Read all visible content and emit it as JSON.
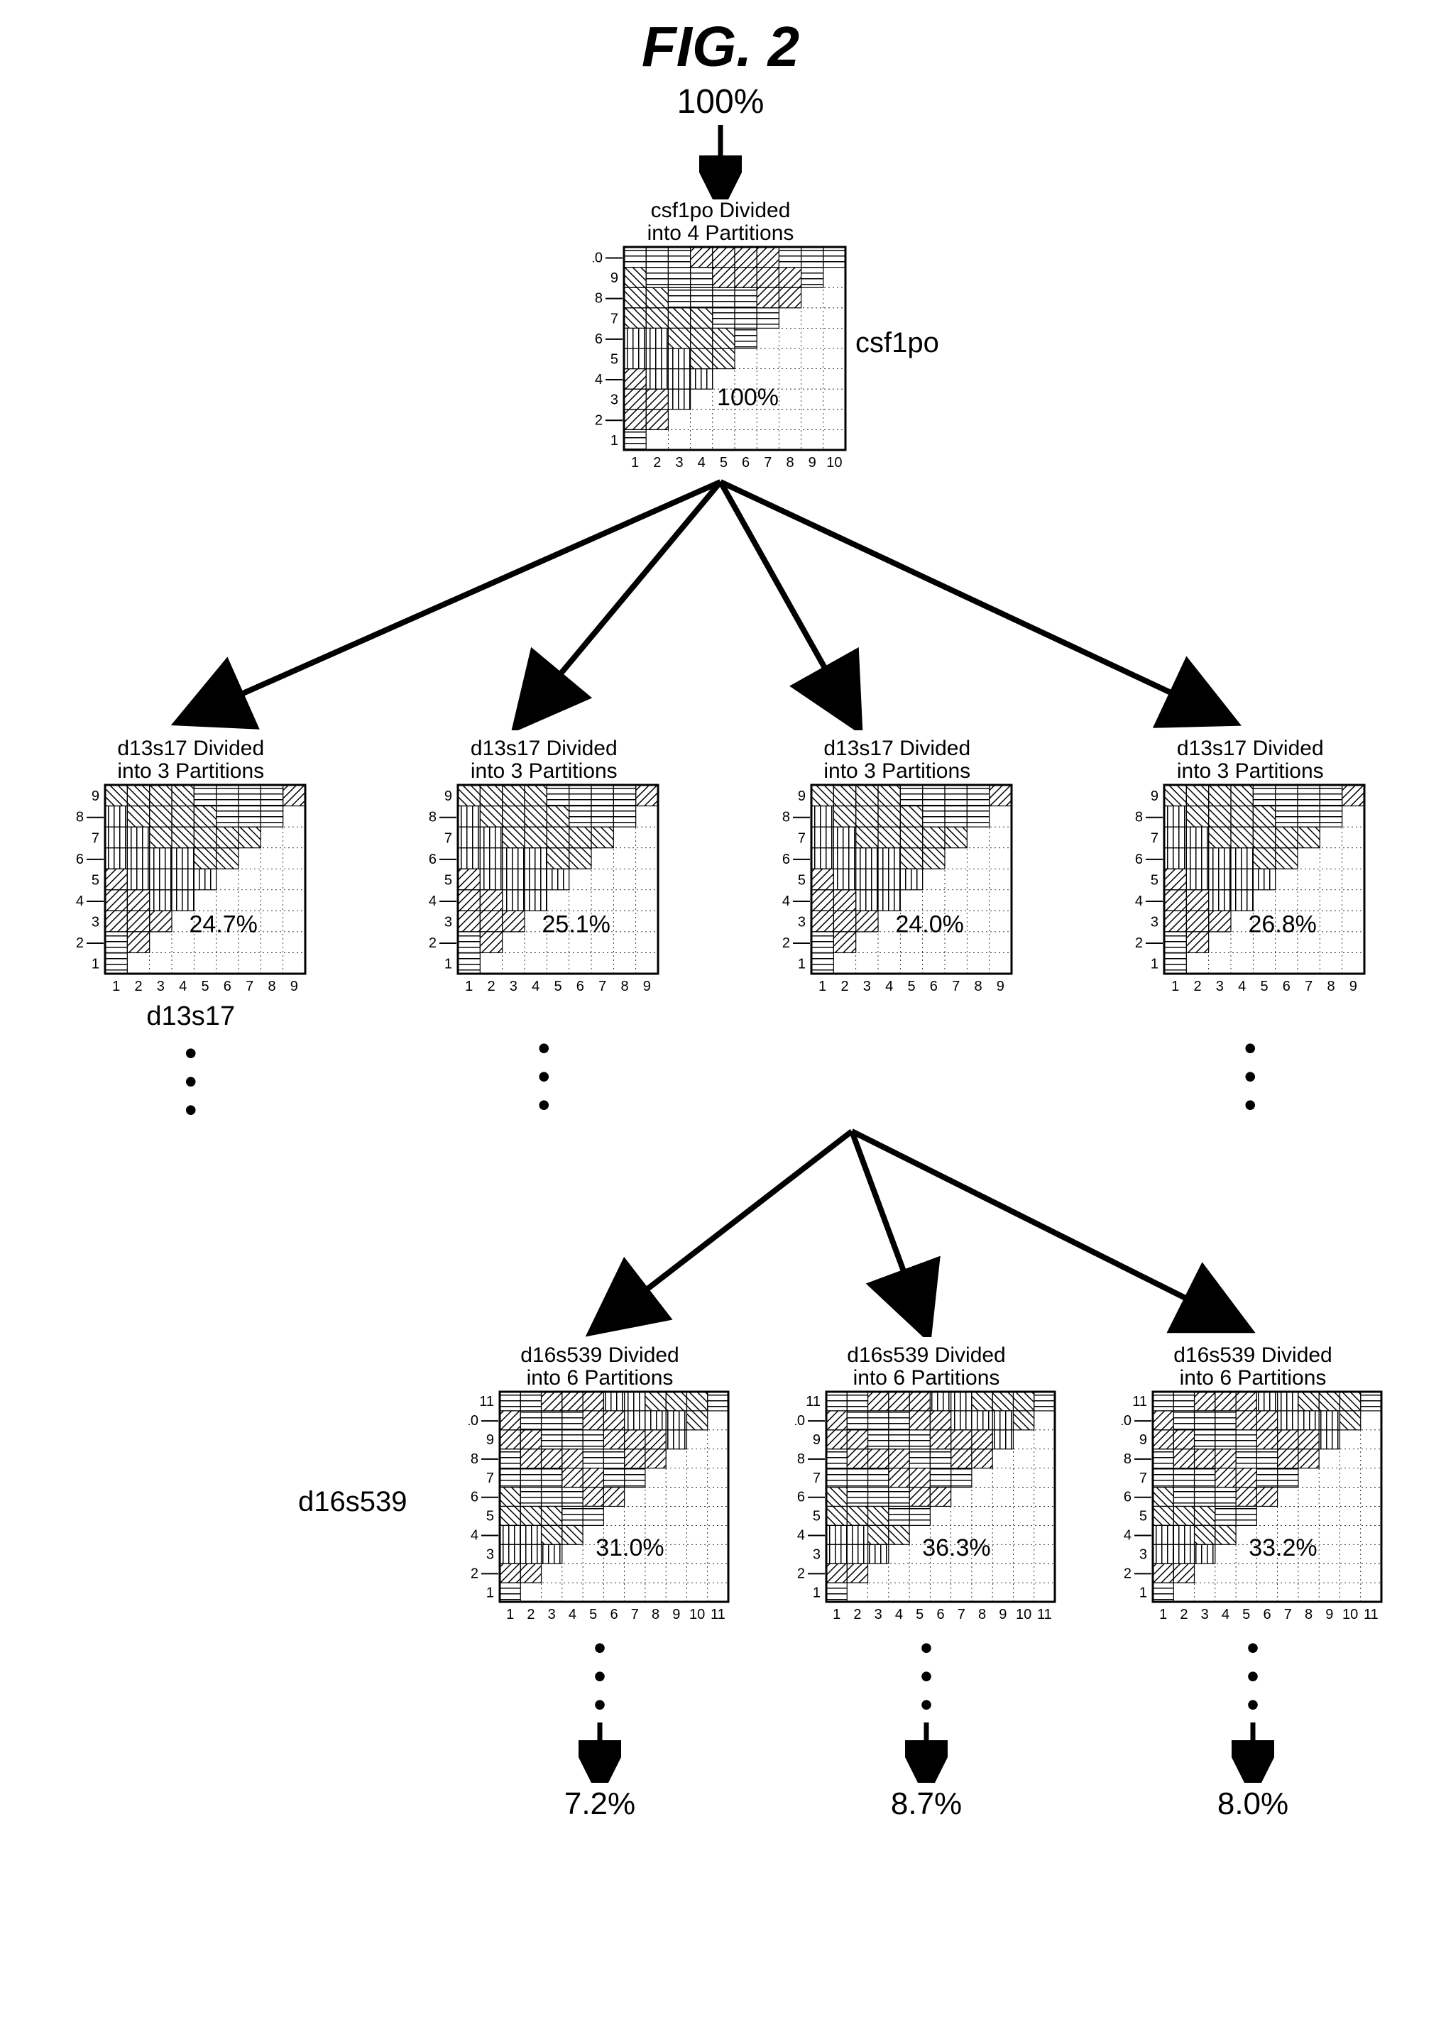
{
  "figure_label": "FIG. 2",
  "root": {
    "percent_in": "100%",
    "title_line1": "csf1po Divided",
    "title_line2": "into 4 Partitions",
    "side_label": "csf1po",
    "inner_pct": "100%",
    "axis_max": 10
  },
  "level2_common": {
    "title_line1": "d13s17 Divided",
    "title_line2": "into 3 Partitions",
    "axis_max": 9,
    "side_label": "d13s17"
  },
  "level2": [
    {
      "inner_pct": "24.7%"
    },
    {
      "inner_pct": "25.1%"
    },
    {
      "inner_pct": "24.0%"
    },
    {
      "inner_pct": "26.8%"
    }
  ],
  "level3_common": {
    "title_line1": "d16s539 Divided",
    "title_line2": "into 6 Partitions",
    "axis_max": 11,
    "side_label": "d16s539"
  },
  "level3": [
    {
      "inner_pct": "31.0%",
      "final_pct": "7.2%"
    },
    {
      "inner_pct": "36.3%",
      "final_pct": "8.7%"
    },
    {
      "inner_pct": "33.2%",
      "final_pct": "8.0%"
    }
  ],
  "chart_data": {
    "type": "tree/partition-diagram",
    "description": "Hierarchical partition tree. Root locus csf1po (10x10 allele grid) split into 4 partitions (~24.7/25.1/24.0/26.8%). Each child is locus d13s17 (9x9 grid) split into 3 partitions. Third child expands to locus d16s539 (11x11 grid) split into 6 partitions with branch %s 31.0/36.3/33.2 and terminal %s 7.2/8.7/8.0.",
    "root": {
      "locus": "csf1po",
      "grid": 10,
      "partitions": 4,
      "incoming_pct": 100,
      "children_pct": [
        24.7,
        25.1,
        24.0,
        26.8
      ]
    },
    "level2": {
      "locus": "d13s17",
      "grid": 9,
      "partitions": 3
    },
    "level3_from_child_index": 2,
    "level3": {
      "locus": "d16s539",
      "grid": 11,
      "partitions": 6,
      "branch_pct": [
        31.0,
        36.3,
        33.2
      ],
      "terminal_pct": [
        7.2,
        8.7,
        8.0
      ]
    }
  }
}
